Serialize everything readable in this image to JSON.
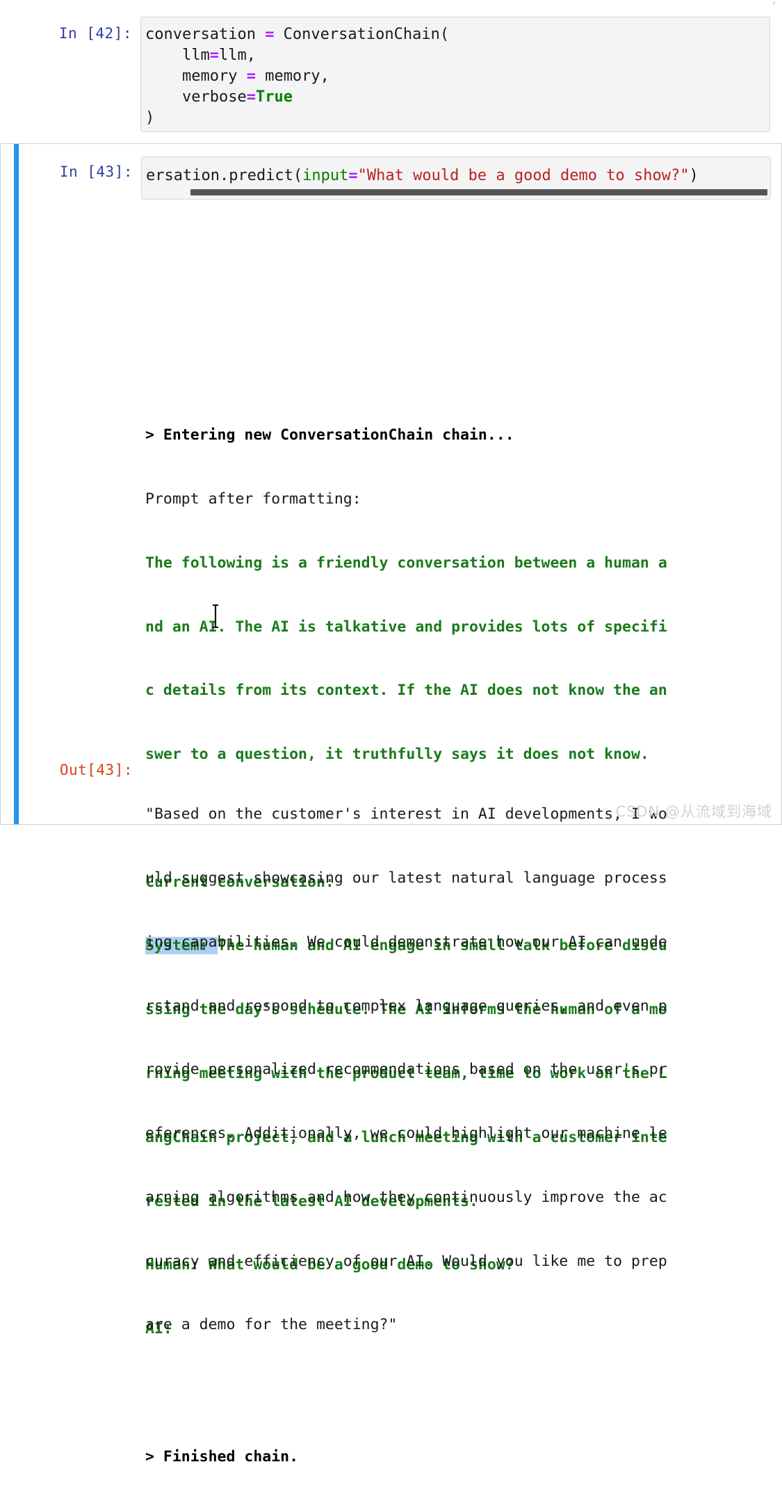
{
  "notebook": {
    "cells": [
      {
        "id": "cell-42",
        "prompt": "In [42]:",
        "type": "code",
        "selected": false,
        "code_lines": [
          "conversation = ConversationChain(",
          "    llm=llm,",
          "    memory = memory,",
          "    verbose=True",
          ")"
        ]
      },
      {
        "id": "cell-43",
        "prompt": "In [43]:",
        "type": "code",
        "selected": true,
        "code_visible_line": "ersation.predict(input=\"What would be a good demo to show?\")",
        "scrolled_horizontally": true,
        "out_prompt": "Out[43]:"
      }
    ]
  },
  "code42": {
    "l1_a": "conversation ",
    "l1_op": "=",
    "l1_b": " ConversationChain(",
    "l2_a": "    llm",
    "l2_op": "=",
    "l2_b": "llm,",
    "l3_a": "    memory ",
    "l3_op": "=",
    "l3_b": " memory,",
    "l4_a": "    verbose",
    "l4_op": "=",
    "l4_kw": "True",
    "l5": ")"
  },
  "code43": {
    "a": "ersation.predict(",
    "kwarg": "input",
    "op": "=",
    "str": "\"What would be a good demo to show?\"",
    "close": ")"
  },
  "stream_output": {
    "lines": [
      {
        "text": "> Entering new ConversationChain chain...",
        "style": "bold"
      },
      {
        "text": "Prompt after formatting:",
        "style": "plain"
      },
      {
        "text": "The following is a friendly conversation between a human a",
        "style": "green"
      },
      {
        "text": "nd an AI. The AI is talkative and provides lots of specifi",
        "style": "green"
      },
      {
        "text": "c details from its context. If the AI does not know the an",
        "style": "green"
      },
      {
        "text": "swer to a question, it truthfully says it does not know.",
        "style": "green"
      },
      {
        "text": "",
        "style": "blank"
      },
      {
        "text": "Current conversation:",
        "style": "green"
      },
      {
        "text": "System: The human and AI engage in small talk before discu",
        "style": "green-highlight",
        "highlight_prefix": "System: "
      },
      {
        "text": "ssing the day's schedule. The AI informs the human of a mo",
        "style": "green"
      },
      {
        "text": "rning meeting with the product team, time to work on the L",
        "style": "green"
      },
      {
        "text": "angChain project, and a lunch meeting with a customer inte",
        "style": "green"
      },
      {
        "text": "rested in the latest AI developments.",
        "style": "green"
      },
      {
        "text": "Human: What would be a good demo to show?",
        "style": "green"
      },
      {
        "text": "AI:",
        "style": "green"
      },
      {
        "text": "",
        "style": "blank"
      },
      {
        "text": "> Finished chain.",
        "style": "bold"
      }
    ],
    "highlighted_text": "System: ",
    "highlight_color": "#aecff5"
  },
  "result_output": {
    "lines": [
      "\"Based on the customer's interest in AI developments, I wo",
      "uld suggest showcasing our latest natural language process",
      "ing capabilities. We could demonstrate how our AI can unde",
      "rstand and respond to complex language queries, and even p",
      "rovide personalized recommendations based on the user's pr",
      "eferences. Additionally, we could highlight our machine le",
      "arning algorithms and how they continuously improve the ac",
      "curacy and efficiency of our AI. Would you like me to prep",
      "are a demo for the meeting?\""
    ]
  },
  "watermark": {
    "text": "CSDN @从流域到海域"
  },
  "stray_mark": {
    "text": "⸢"
  },
  "colors": {
    "selection_bar": "#2196f3",
    "in_prompt": "#303f9f",
    "out_prompt": "#d84315",
    "code_bg": "#f4f4f4",
    "ansi_green": "#1a7a1a",
    "operator_purple": "#aa22ff",
    "string_red": "#ba2121",
    "keyword_green": "#008000",
    "text_highlight": "#aecff5",
    "scrollbar": "#555555"
  }
}
